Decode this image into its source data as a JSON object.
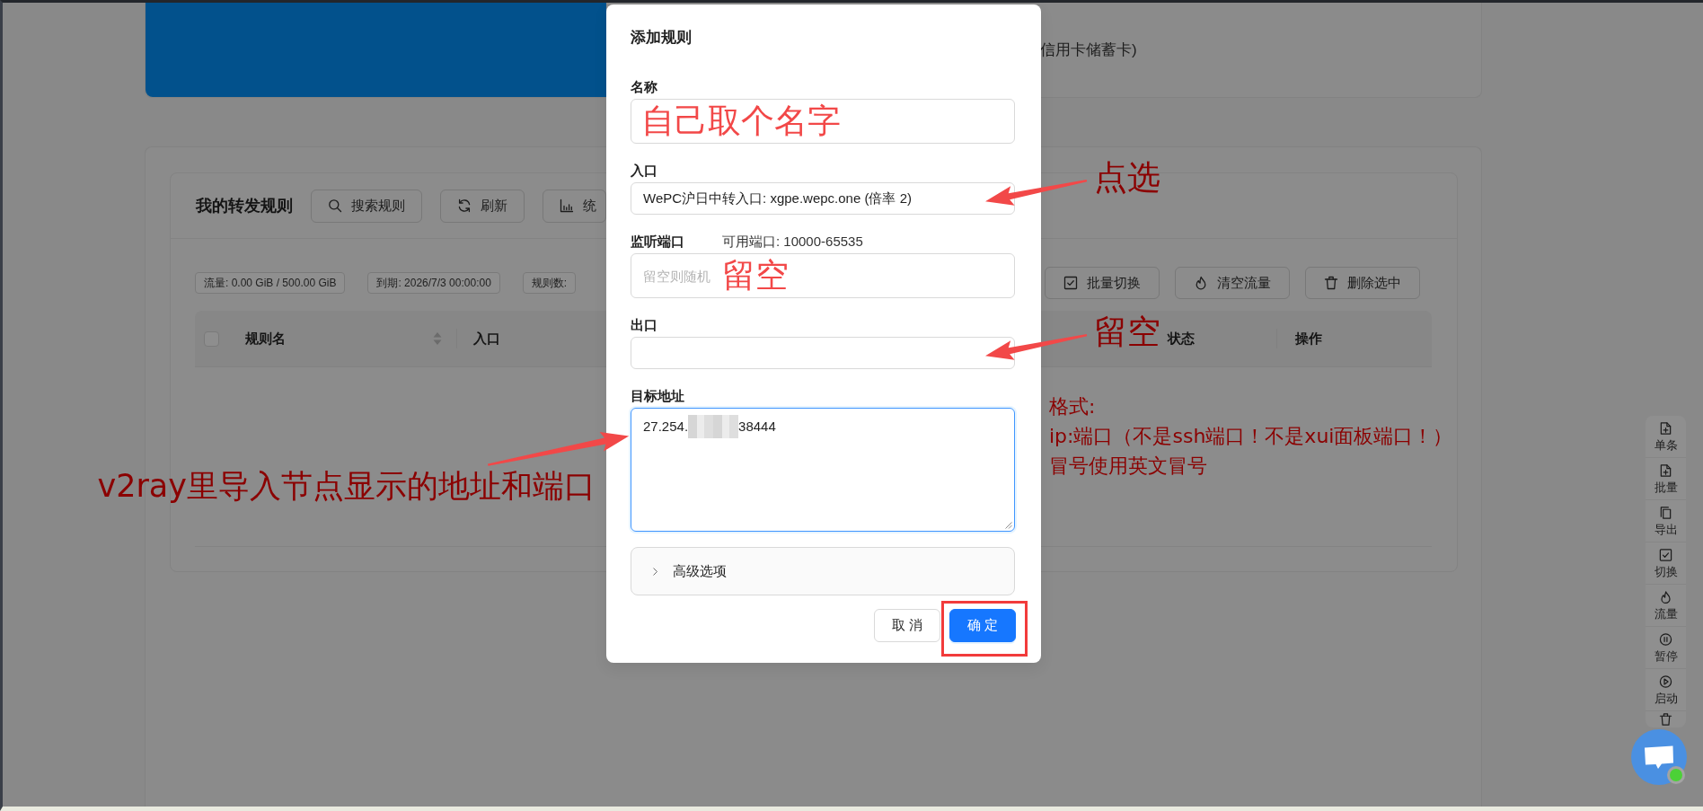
{
  "background": {
    "banner": {
      "text": "信用卡储蓄卡)"
    },
    "rules": {
      "title": "我的转发规则",
      "toolbar": [
        "搜索规则",
        "刷新",
        "统"
      ],
      "chips": [
        "流量: 0.00 GiB / 500.00 GiB",
        "到期: 2026/7/3 00:00:00",
        "规则数:"
      ],
      "bulk_actions": [
        "批量切换",
        "清空流量",
        "删除选中"
      ],
      "table": {
        "select_all": {
          "checked": false
        },
        "columns": [
          {
            "label": "规则名",
            "sortable": true
          },
          {
            "label": "入口",
            "sortable": false
          },
          {
            "label": "状态",
            "sortable": false
          },
          {
            "label": "操作",
            "sortable": false
          }
        ]
      }
    }
  },
  "side_toolbar": {
    "items": [
      "单条",
      "批量",
      "导出",
      "切换",
      "流量",
      "暂停",
      "启动"
    ]
  },
  "chat": {
    "online": true
  },
  "dialog": {
    "title": "添加规则",
    "fields": [
      {
        "kind": "input",
        "label": "名称",
        "annotations": [
          {
            "kind": "inline",
            "text": "自己取个名字"
          }
        ]
      },
      {
        "kind": "select",
        "label": "入口",
        "value": "WePC沪日中转入口: xgpe.wepc.one (倍率 2)",
        "annotations": [
          {
            "kind": "callout-right",
            "text": "点选"
          }
        ]
      },
      {
        "kind": "input",
        "label": "监听端口",
        "hint": "可用端口: 10000-65535",
        "placeholder": "留空则随机",
        "annotations": [
          {
            "kind": "inline",
            "text": "留空"
          }
        ]
      },
      {
        "kind": "select",
        "label": "出口",
        "annotations": [
          {
            "kind": "callout-right",
            "text": "留空"
          }
        ]
      },
      {
        "kind": "textarea",
        "label": "目标地址",
        "focused": true,
        "value_before": "27.254.",
        "redacted": true,
        "value_after": "38444",
        "annotations": [
          {
            "kind": "note",
            "lines": [
              "格式:",
              "ip:端口（不是ssh端口！不是xui面板端口！）",
              "冒号使用英文冒号"
            ]
          },
          {
            "kind": "callout-left",
            "text": "v2ray里导入节点显示的地址和端口"
          }
        ]
      }
    ],
    "advanced": {
      "label": "高级选项",
      "expanded": false
    },
    "buttons": [
      {
        "kind": "default",
        "label": "取 消",
        "highlighted": false
      },
      {
        "kind": "primary",
        "label": "确 定",
        "highlighted": true
      }
    ]
  }
}
